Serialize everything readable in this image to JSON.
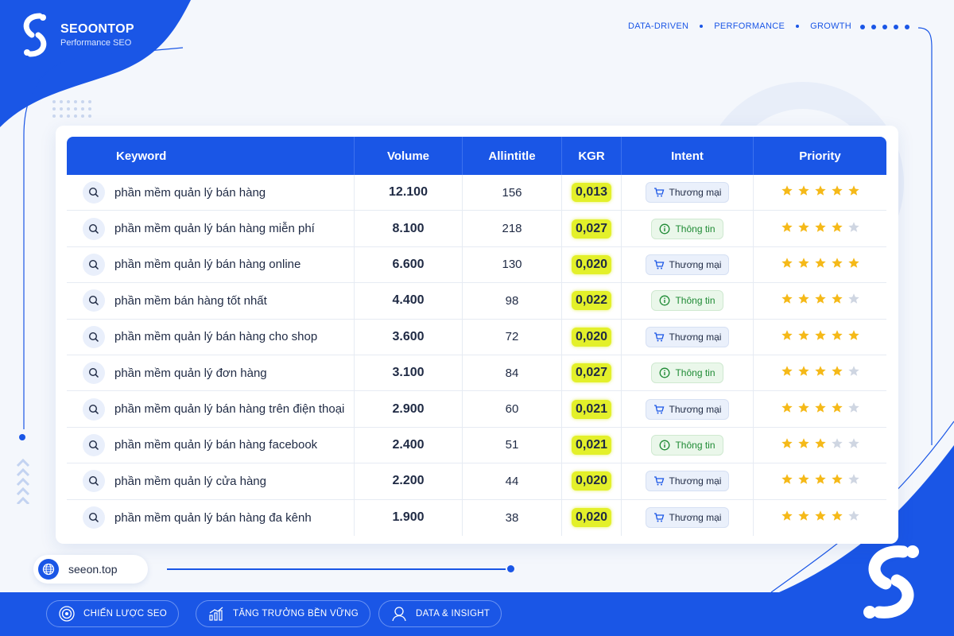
{
  "brand": {
    "name": "SEOONTOP",
    "tagline": "Performance SEO",
    "url": "seeon.top"
  },
  "topnav": [
    "DATA-DRIVEN",
    "PERFORMANCE",
    "GROWTH"
  ],
  "table": {
    "headers": [
      "Keyword",
      "Volume",
      "Allintitle",
      "KGR",
      "Intent",
      "Priority"
    ],
    "rows": [
      {
        "keyword": "phần mềm quản lý bán hàng",
        "volume": "12.100",
        "allintitle": "156",
        "kgr": "0,013",
        "intent": "Thương mại",
        "intent_type": "commercial",
        "stars": 5
      },
      {
        "keyword": "phần mềm quản lý bán hàng miễn phí",
        "volume": "8.100",
        "allintitle": "218",
        "kgr": "0,027",
        "intent": "Thông tin",
        "intent_type": "informational",
        "stars": 4
      },
      {
        "keyword": "phần mềm quản lý bán hàng online",
        "volume": "6.600",
        "allintitle": "130",
        "kgr": "0,020",
        "intent": "Thương mại",
        "intent_type": "commercial",
        "stars": 5
      },
      {
        "keyword": "phần mềm bán hàng tốt nhất",
        "volume": "4.400",
        "allintitle": "98",
        "kgr": "0,022",
        "intent": "Thông tin",
        "intent_type": "informational",
        "stars": 4
      },
      {
        "keyword": "phần mềm quản lý bán hàng cho shop",
        "volume": "3.600",
        "allintitle": "72",
        "kgr": "0,020",
        "intent": "Thương mại",
        "intent_type": "commercial",
        "stars": 5
      },
      {
        "keyword": "phần mềm quản lý đơn hàng",
        "volume": "3.100",
        "allintitle": "84",
        "kgr": "0,027",
        "intent": "Thông tin",
        "intent_type": "informational",
        "stars": 4
      },
      {
        "keyword": "phần mềm quản lý bán hàng trên điện thoại",
        "volume": "2.900",
        "allintitle": "60",
        "kgr": "0,021",
        "intent": "Thương mại",
        "intent_type": "commercial",
        "stars": 4
      },
      {
        "keyword": "phần mềm quản lý bán hàng facebook",
        "volume": "2.400",
        "allintitle": "51",
        "kgr": "0,021",
        "intent": "Thông tin",
        "intent_type": "informational",
        "stars": 3
      },
      {
        "keyword": "phần mềm quản lý cửa hàng",
        "volume": "2.200",
        "allintitle": "44",
        "kgr": "0,020",
        "intent": "Thương mại",
        "intent_type": "commercial",
        "stars": 4
      },
      {
        "keyword": "phần mềm quản lý bán hàng đa kênh",
        "volume": "1.900",
        "allintitle": "38",
        "kgr": "0,020",
        "intent": "Thương mại",
        "intent_type": "commercial",
        "stars": 4
      }
    ],
    "max_stars": 5
  },
  "footer_pills": [
    {
      "label": "CHIẾN LƯỢC SEO",
      "icon": "target-icon"
    },
    {
      "label": "TĂNG TRƯỞNG BỀN VỮNG",
      "icon": "growth-chart-icon"
    },
    {
      "label": "DATA & INSIGHT",
      "icon": "analytics-person-icon"
    }
  ],
  "colors": {
    "primary": "#1a56e6",
    "kgr_highlight": "#e3f02a",
    "star_on": "#f5b918",
    "star_off": "#cfd6e2",
    "info_green": "#1e8a34"
  }
}
